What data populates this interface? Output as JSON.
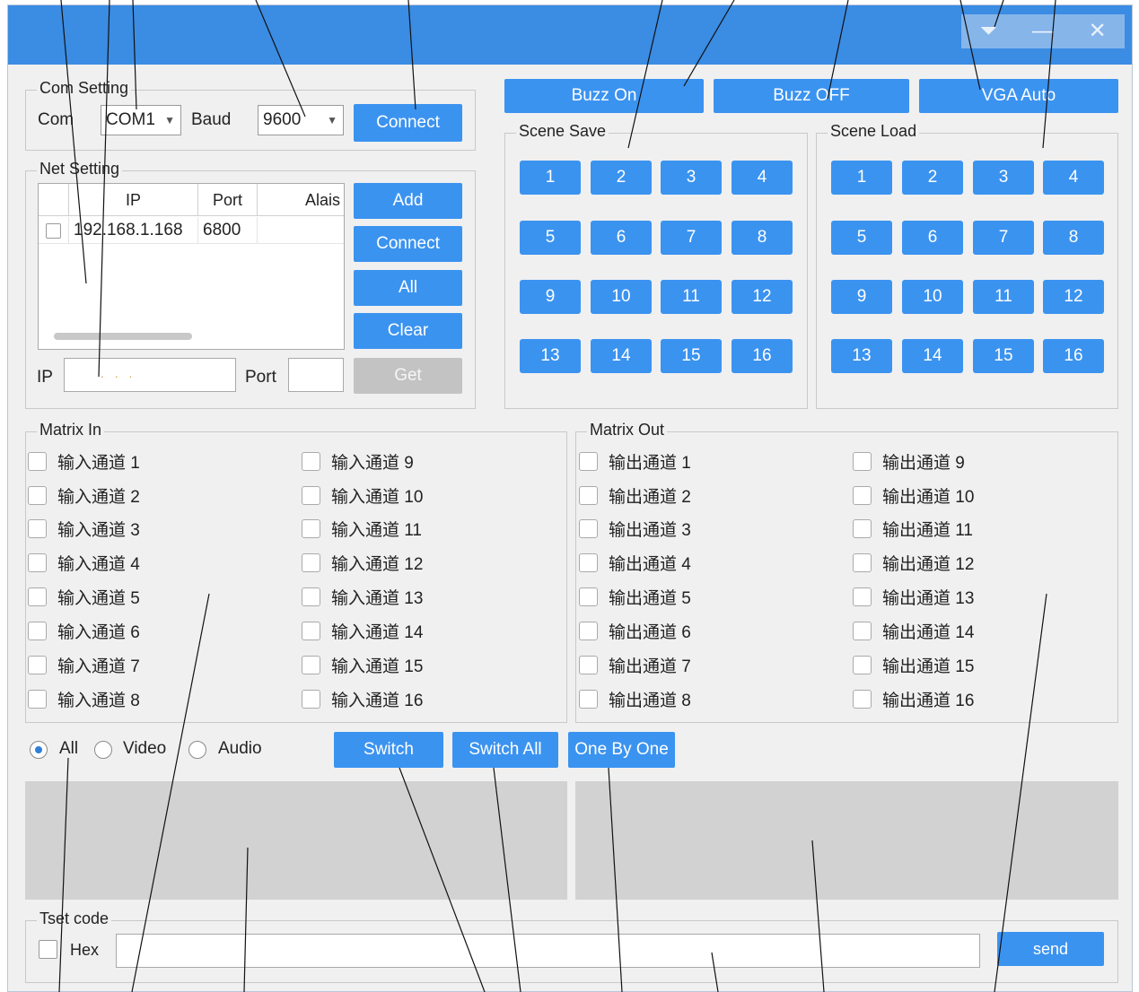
{
  "titlebar": {
    "ctrl_menu": "⏷",
    "ctrl_min": "—",
    "ctrl_close": "✕"
  },
  "com_setting": {
    "legend": "Com Setting",
    "com_label": "Com",
    "com_value": "COM1",
    "baud_label": "Baud",
    "baud_value": "9600",
    "connect": "Connect"
  },
  "net_setting": {
    "legend": "Net Setting",
    "columns": [
      "IP",
      "Port",
      "Alais"
    ],
    "rows": [
      {
        "ip": "192.168.1.168",
        "port": "6800",
        "alias": ""
      }
    ],
    "ip_label": "IP",
    "port_label": "Port",
    "ip_placeholder": ".    .    .",
    "buttons": {
      "add": "Add",
      "connect": "Connect",
      "all": "All",
      "clear": "Clear",
      "get": "Get"
    }
  },
  "top_buttons": {
    "buzz_on": "Buzz On",
    "buzz_off": "Buzz OFF",
    "vga_auto": "VGA Auto"
  },
  "scene_save": {
    "legend": "Scene Save",
    "buttons": [
      "1",
      "2",
      "3",
      "4",
      "5",
      "6",
      "7",
      "8",
      "9",
      "10",
      "11",
      "12",
      "13",
      "14",
      "15",
      "16"
    ]
  },
  "scene_load": {
    "legend": "Scene Load",
    "buttons": [
      "1",
      "2",
      "3",
      "4",
      "5",
      "6",
      "7",
      "8",
      "9",
      "10",
      "11",
      "12",
      "13",
      "14",
      "15",
      "16"
    ]
  },
  "matrix_in": {
    "legend": "Matrix In",
    "channels": [
      "输入通道 1",
      "输入通道 2",
      "输入通道 3",
      "输入通道 4",
      "输入通道 5",
      "输入通道 6",
      "输入通道 7",
      "输入通道 8",
      "输入通道 9",
      "输入通道 10",
      "输入通道 11",
      "输入通道 12",
      "输入通道 13",
      "输入通道 14",
      "输入通道 15",
      "输入通道 16"
    ]
  },
  "matrix_out": {
    "legend": "Matrix Out",
    "channels": [
      "输出通道 1",
      "输出通道 2",
      "输出通道 3",
      "输出通道 4",
      "输出通道 5",
      "输出通道 6",
      "输出通道 7",
      "输出通道 8",
      "输出通道 9",
      "输出通道 10",
      "输出通道 11",
      "输出通道 12",
      "输出通道 13",
      "输出通道 14",
      "输出通道 15",
      "输出通道 16"
    ]
  },
  "mode": {
    "all": "All",
    "video": "Video",
    "audio": "Audio",
    "selected": "All"
  },
  "actions": {
    "switch": "Switch",
    "switch_all": "Switch All",
    "one_by_one": "One By One"
  },
  "test_code": {
    "legend": "Tset code",
    "hex": "Hex",
    "value": "",
    "send": "send"
  },
  "colors": {
    "accent": "#3b93f0",
    "titlebar": "#3b8ce3",
    "disabled": "#c3c3c3"
  }
}
